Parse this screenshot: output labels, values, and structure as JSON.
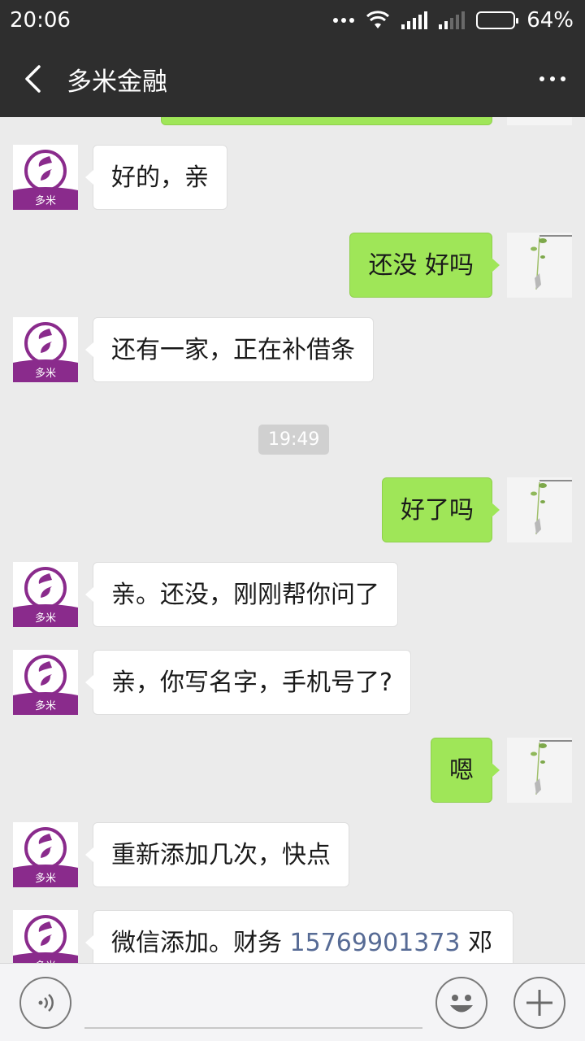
{
  "status_bar": {
    "time": "20:06",
    "battery": "64%",
    "battery_level": 0.64,
    "icons": [
      "more-dots-icon",
      "wifi-icon",
      "signal-icon",
      "signal-icon",
      "battery-icon"
    ]
  },
  "header": {
    "back_icon": "chevron-left-icon",
    "title": "多米金融",
    "more_icon": "more-horizontal-icon"
  },
  "messages": [
    {
      "side": "in",
      "text": "好的，亲"
    },
    {
      "side": "out",
      "text": "还没 好吗"
    },
    {
      "side": "in",
      "text": "还有一家，正在补借条"
    },
    {
      "type": "time",
      "text": "19:49"
    },
    {
      "side": "out",
      "text": "好了吗"
    },
    {
      "side": "in",
      "text": "亲。还没，刚刚帮你问了"
    },
    {
      "side": "in",
      "text": "亲，你写名字，手机号了?"
    },
    {
      "side": "out",
      "text": "嗯"
    },
    {
      "side": "in",
      "text": "重新添加几次，快点"
    },
    {
      "side": "in",
      "text_prefix": "微信添加。财务 ",
      "phone": "15769901373",
      "text_suffix": "邓"
    }
  ],
  "avatar_text": "多米",
  "input_bar": {
    "voice_icon": "voice-icon",
    "emoji_icon": "emoji-icon",
    "plus_icon": "plus-icon"
  },
  "colors": {
    "header_bg": "#2e2e2e",
    "chat_bg": "#ebebeb",
    "outgoing_bubble": "#9fe658",
    "incoming_bubble": "#ffffff",
    "link": "#576b95",
    "brand_purple": "#8a2b8c"
  }
}
